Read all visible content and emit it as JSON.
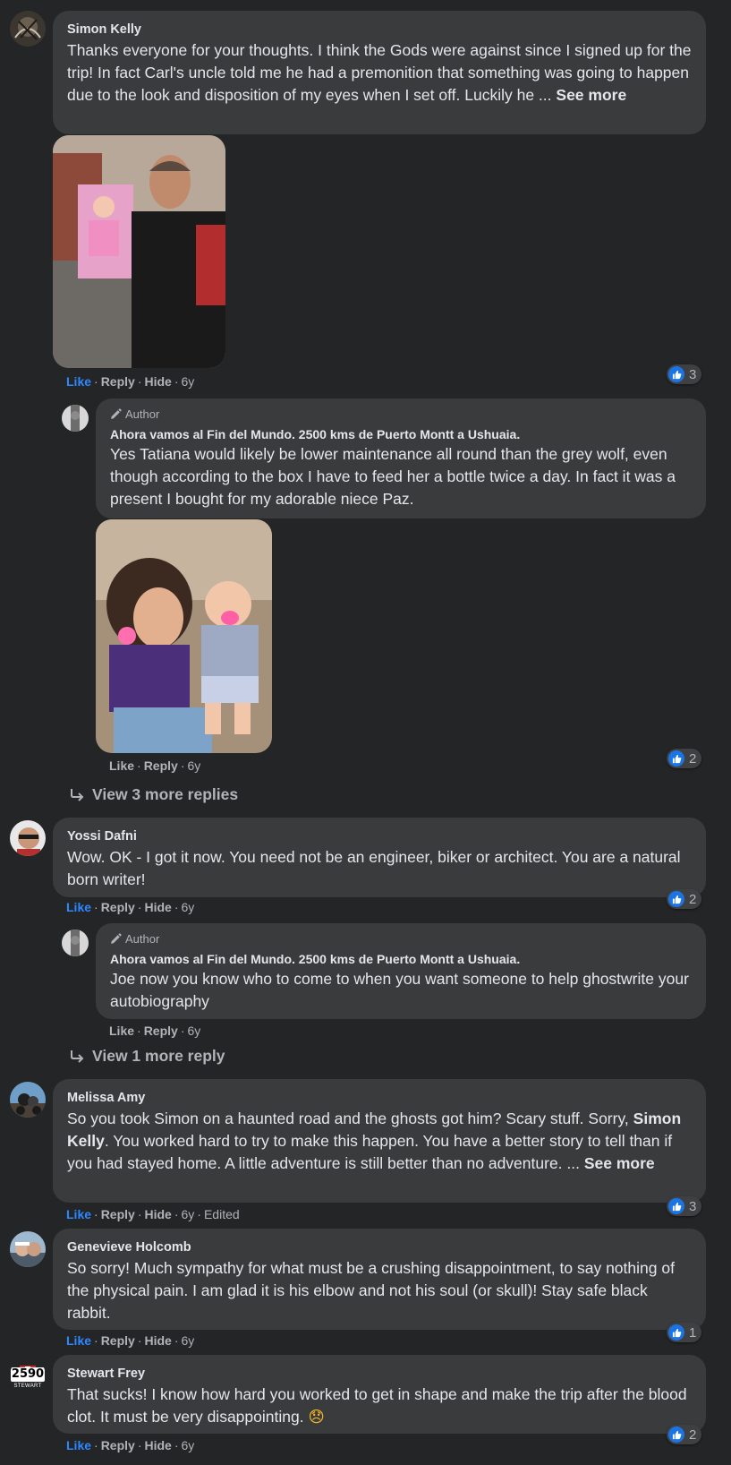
{
  "comments": [
    {
      "author": "Simon Kelly",
      "text": "Thanks everyone for your thoughts. I think the Gods were against since I signed up for the trip! In fact Carl's uncle told me he had a premonition that something was going to happen due to the look and disposition of my eyes when I set off. Luckily he ...",
      "see_more": "See more",
      "actions": {
        "like": "Like",
        "reply": "Reply",
        "hide": "Hide",
        "time": "6y"
      },
      "reactions": "3"
    },
    {
      "author": "Yossi Dafni",
      "text": "Wow. OK - I got it now. You need not be an engineer, biker or architect. You are a natural born writer!",
      "actions": {
        "like": "Like",
        "reply": "Reply",
        "hide": "Hide",
        "time": "6y"
      },
      "reactions": "2"
    },
    {
      "author": "Melissa Amy",
      "text_a": "So you took Simon on a haunted road and the ghosts got him? Scary stuff. Sorry,",
      "mention": "Simon Kelly",
      "text_b": ". You worked hard to try to make this happen. You have a better story to tell than if you had stayed home. A little adventure is still better than no adventure. ...",
      "see_more": "See more",
      "actions": {
        "like": "Like",
        "reply": "Reply",
        "hide": "Hide",
        "time": "6y",
        "edited": "Edited"
      },
      "reactions": "3"
    },
    {
      "author": "Genevieve Holcomb",
      "text": "So sorry! Much sympathy for what must be a crushing disappointment, to say nothing of the physical pain. I am glad it is his elbow and not his soul (or skull)! Stay safe black rabbit.",
      "actions": {
        "like": "Like",
        "reply": "Reply",
        "hide": "Hide",
        "time": "6y"
      },
      "reactions": "1"
    },
    {
      "author": "Stewart Frey",
      "avatar_text": "2590",
      "avatar_subtext": "STEWART",
      "text": "That sucks! I know how hard you worked to get in shape and make the trip after the blood clot. It must be very disappointing.",
      "emoji": "😞",
      "actions": {
        "like": "Like",
        "reply": "Reply",
        "hide": "Hide",
        "time": "6y"
      },
      "reactions": "2"
    }
  ],
  "replies": [
    {
      "badge": "Author",
      "author": "Ahora vamos al Fin del Mundo. 2500 kms de Puerto Montt a Ushuaia.",
      "text": "Yes Tatiana would likely be lower maintenance all round than the grey wolf, even though according to the box I have to feed her a bottle twice a day. In fact it was a present I bought for my adorable niece Paz.",
      "actions": {
        "like": "Like",
        "reply": "Reply",
        "time": "6y"
      },
      "reactions": "2"
    },
    {
      "badge": "Author",
      "author": "Ahora vamos al Fin del Mundo. 2500 kms de Puerto Montt a Ushuaia.",
      "text": "Joe now you know who to come to when you want someone to help ghostwrite your autobiography",
      "actions": {
        "like": "Like",
        "reply": "Reply",
        "time": "6y"
      }
    }
  ],
  "view_more": [
    "View 3 more replies",
    "View 1 more reply"
  ],
  "colors": {
    "background": "#242526",
    "bubble": "#3a3b3c",
    "like_blue": "#2d88ff",
    "secondary": "#b0b3b8"
  }
}
